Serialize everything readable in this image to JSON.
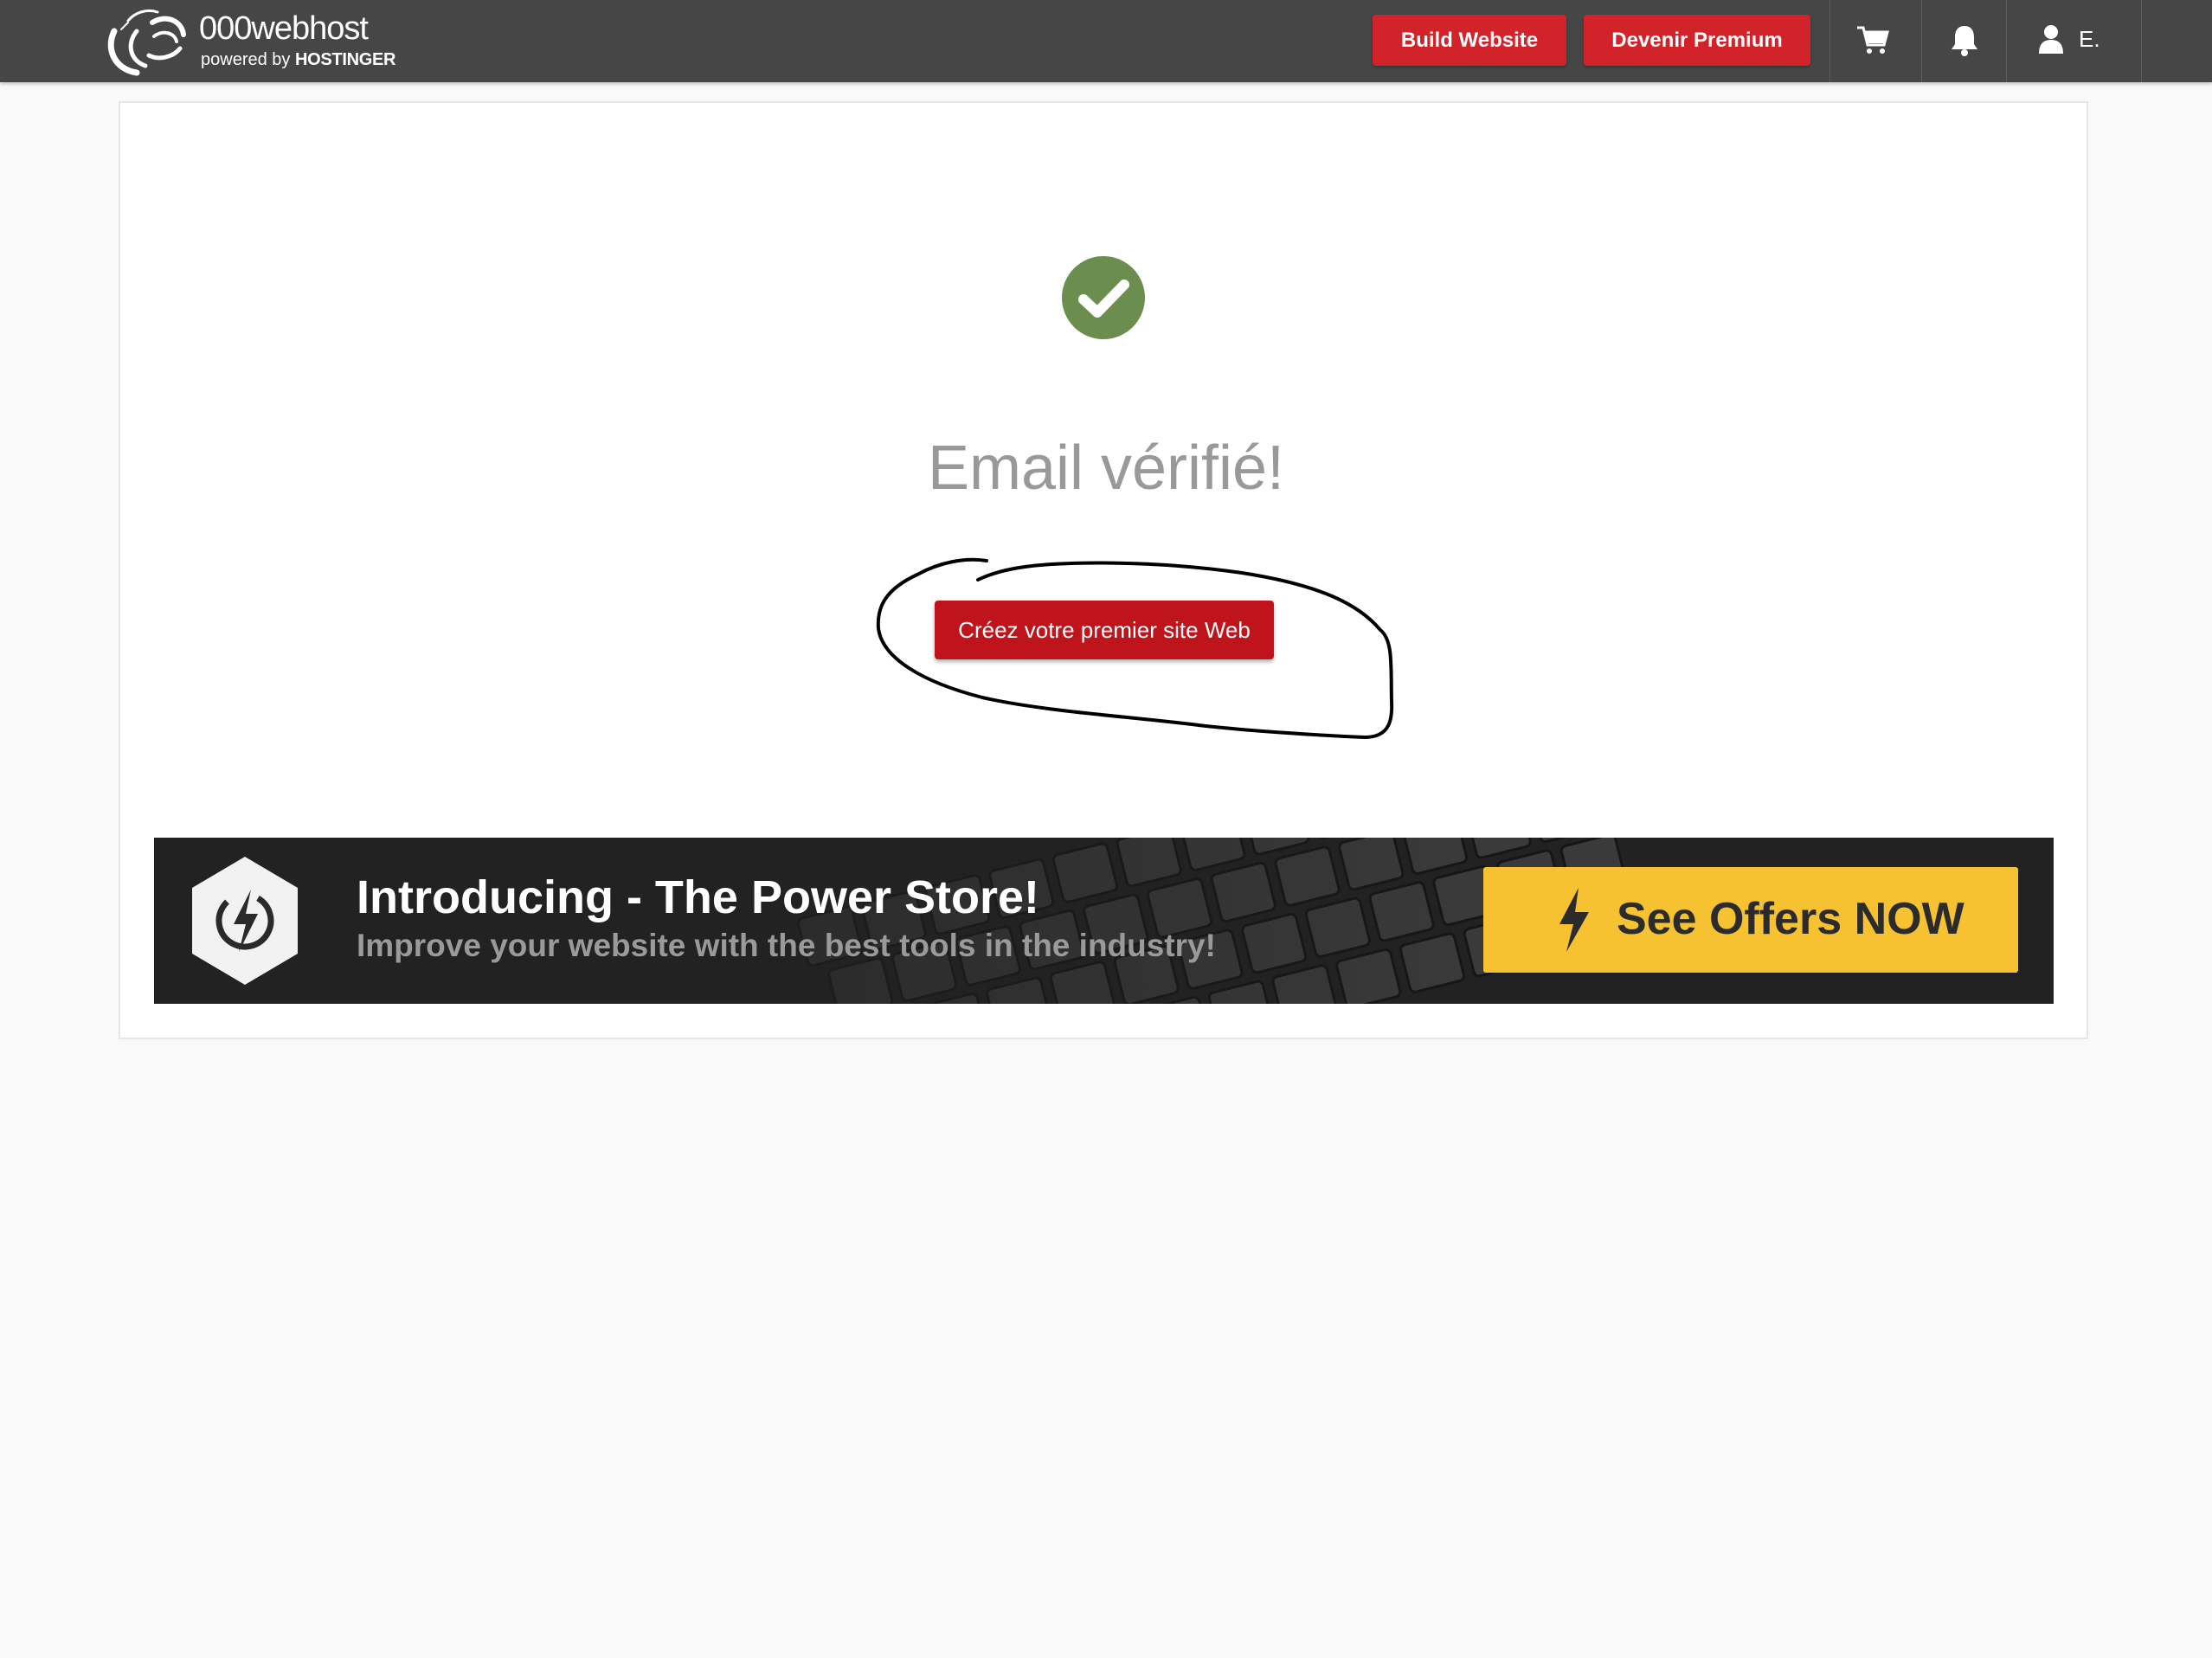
{
  "header": {
    "logo_name": "000webhost",
    "logo_powered": "powered by",
    "logo_brand": "HOSTINGER",
    "build_website_label": "Build Website",
    "premium_label": "Devenir Premium",
    "user_label": "E.",
    "icons": [
      "cart-icon",
      "bell-icon",
      "user-icon"
    ]
  },
  "main": {
    "status_icon": "check-circle-icon",
    "title": "Email vérifié!",
    "cta_label": "Créez votre premier site Web"
  },
  "banner": {
    "title": "Introducing - The Power Store!",
    "subtitle": "Improve your website with the best tools in the industry!",
    "button_label": "See Offers NOW",
    "icons": [
      "power-hexagon-icon",
      "lightning-bolt-icon"
    ]
  },
  "colors": {
    "topbar": "#464646",
    "primary_red": "#d2232a",
    "cta_red": "#c0141c",
    "success_green": "#6b8e4e",
    "offer_yellow": "#f6c232",
    "banner_dark": "#222222",
    "page_bg": "#f9f9f9"
  }
}
